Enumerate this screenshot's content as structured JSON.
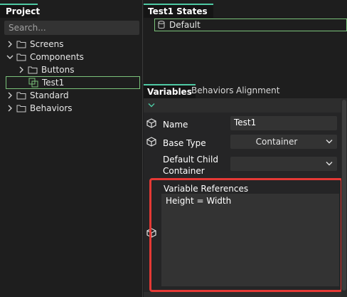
{
  "project_panel": {
    "title": "Project",
    "search_placeholder": "Search...",
    "tree": [
      {
        "label": "Screens",
        "expanded": false,
        "level": 0
      },
      {
        "label": "Components",
        "expanded": true,
        "level": 0
      },
      {
        "label": "Buttons",
        "expanded": false,
        "level": 1
      },
      {
        "label": "Test1",
        "selected": true,
        "level": 2
      },
      {
        "label": "Standard",
        "expanded": false,
        "level": 0
      },
      {
        "label": "Behaviors",
        "expanded": false,
        "level": 0
      }
    ]
  },
  "states_panel": {
    "title": "Test1 States",
    "default_state": "Default"
  },
  "tabs": [
    "Variables",
    "Behaviors",
    "Alignment"
  ],
  "properties": {
    "name_label": "Name",
    "name_value": "Test1",
    "base_type_label": "Base Type",
    "base_type_value": "Container",
    "default_child_label_line1": "Default Child",
    "default_child_label_line2": "Container",
    "default_child_value": "",
    "variable_references_label": "Variable References",
    "variable_references_value": "Height = Width"
  },
  "colors": {
    "accent": "#4ec9a3",
    "highlight_border": "#e53935",
    "selection_border": "#7ac27a",
    "folder": "#c9c9c9"
  }
}
